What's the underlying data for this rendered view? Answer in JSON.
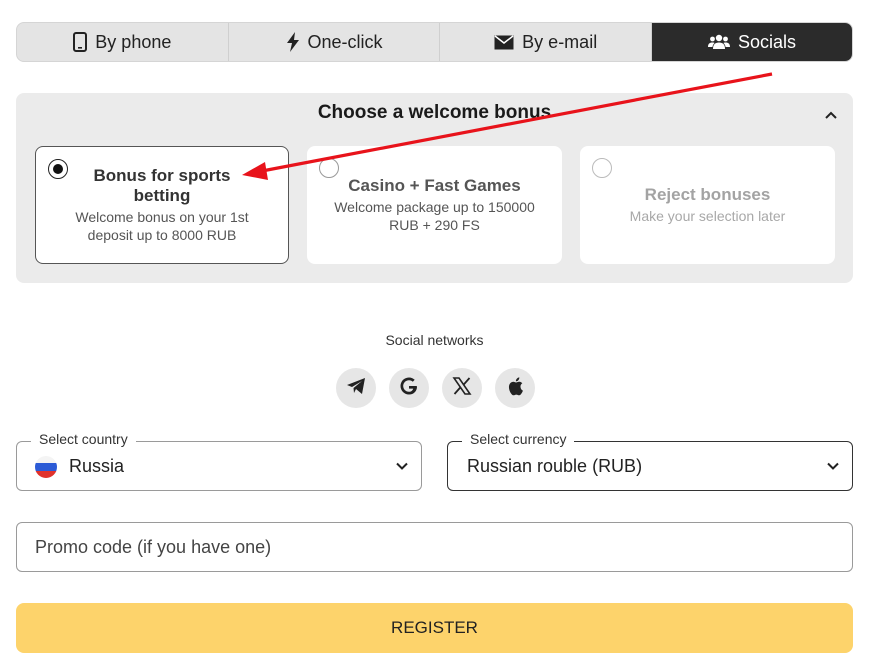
{
  "tabs": [
    {
      "label": "By phone",
      "icon": "phone-icon"
    },
    {
      "label": "One-click",
      "icon": "lightning-icon"
    },
    {
      "label": "By e-mail",
      "icon": "envelope-icon"
    },
    {
      "label": "Socials",
      "icon": "users-icon",
      "active": true
    }
  ],
  "bonus": {
    "title": "Choose a welcome bonus",
    "options": [
      {
        "title": "Bonus for sports betting",
        "subtitle": "Welcome bonus on your 1st deposit up to 8000 RUB",
        "selected": true
      },
      {
        "title": "Casino + Fast Games",
        "subtitle": "Welcome package up to 150000 RUB + 290 FS",
        "selected": false
      },
      {
        "title": "Reject bonuses",
        "subtitle": "Make your selection later",
        "selected": false
      }
    ]
  },
  "social": {
    "label": "Social networks",
    "networks": [
      "telegram-icon",
      "google-icon",
      "x-icon",
      "apple-icon"
    ]
  },
  "country": {
    "legend": "Select country",
    "value": "Russia"
  },
  "currency": {
    "legend": "Select currency",
    "value": "Russian rouble (RUB)"
  },
  "promo": {
    "placeholder": "Promo code (if you have one)"
  },
  "register": {
    "label": "REGISTER"
  },
  "colors": {
    "accent": "#fdd36b",
    "active_tab": "#2b2b2b",
    "annotation_arrow": "#e8131b"
  }
}
